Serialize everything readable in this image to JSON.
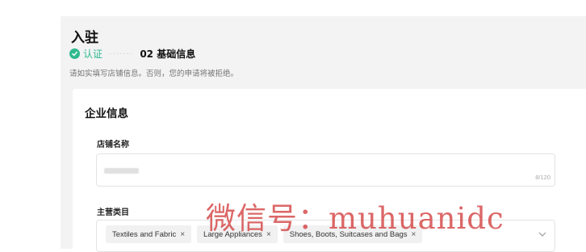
{
  "page": {
    "title": "入驻",
    "steps": [
      {
        "label": "认证",
        "status": "done"
      },
      {
        "label": "02 基础信息",
        "status": "current"
      }
    ],
    "step_separator": "·······",
    "note": "请如实填写店铺信息。否则，您的申请将被拒绝。"
  },
  "enterprise": {
    "title": "企业信息",
    "store_name": {
      "label": "店铺名称",
      "value": "",
      "counter": "8/120"
    },
    "main_category": {
      "label": "主营类目",
      "tags": [
        {
          "label": "Textiles and Fabric",
          "remove": "×"
        },
        {
          "label": "Large Appliances",
          "remove": "×"
        },
        {
          "label": "Shoes, Boots, Suitcases and Bags",
          "remove": "×"
        }
      ]
    }
  },
  "watermark": "微信号：muhuanidc",
  "colors": {
    "success": "#2fba8e",
    "panel_bg": "#f3f3f4",
    "watermark": "#d23c3c"
  }
}
